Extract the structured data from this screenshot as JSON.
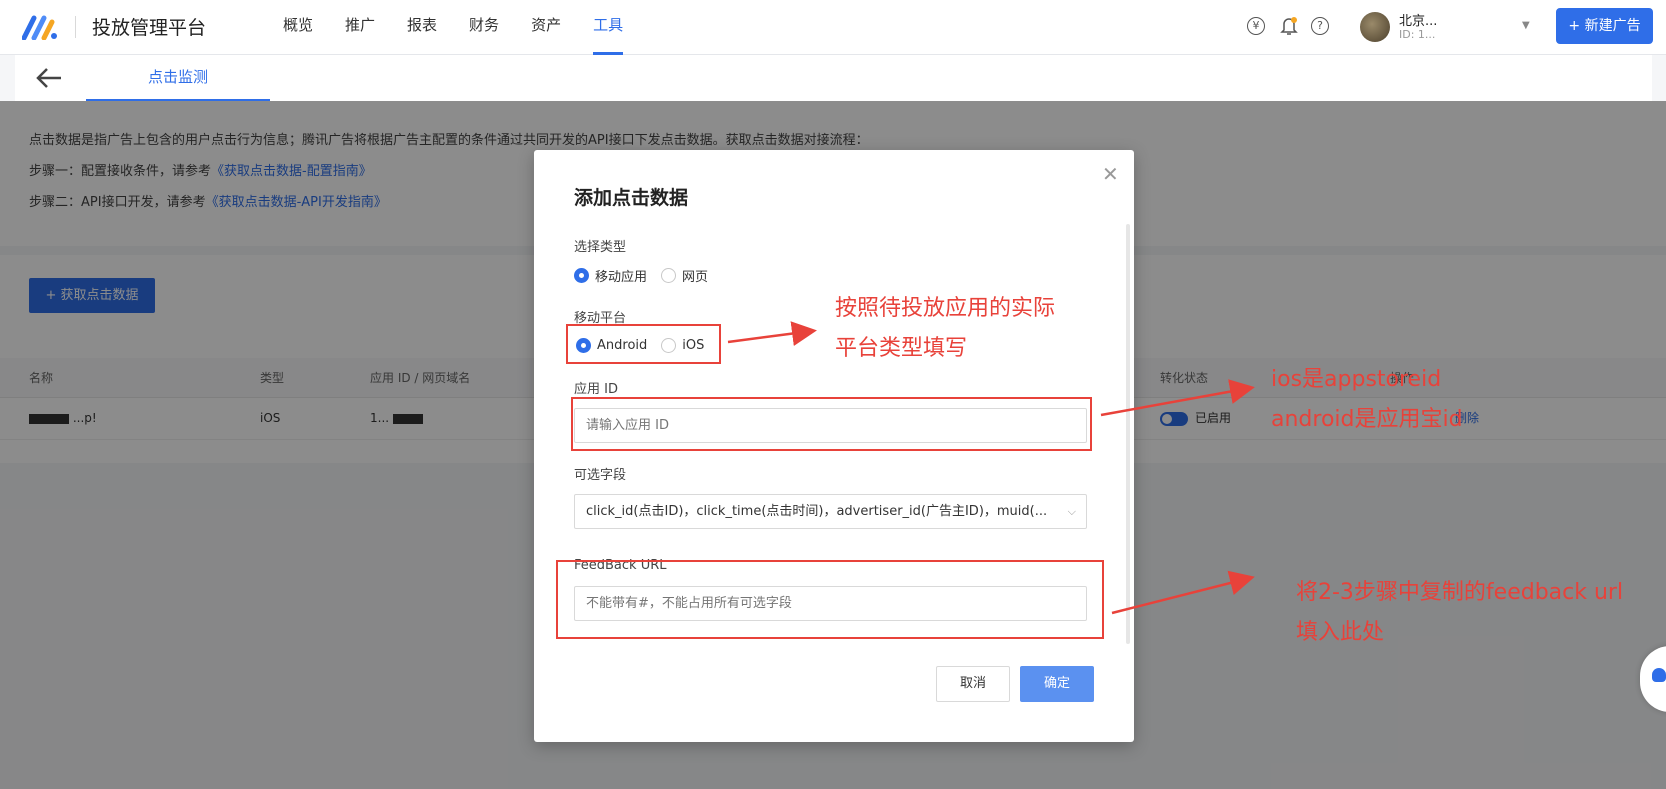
{
  "header": {
    "app_title": "投放管理平台",
    "nav": [
      "概览",
      "推广",
      "报表",
      "财务",
      "资产",
      "工具"
    ],
    "active_nav": "工具",
    "icons": [
      "coin-icon",
      "bell-icon",
      "help-icon"
    ],
    "account_name": "北京...",
    "account_id": "ID: 1...",
    "new_ad_label": "+ 新建广告"
  },
  "subheader": {
    "tab": "点击监测"
  },
  "info": {
    "line1": "点击数据是指广告上包含的用户点击行为信息；腾讯广告将根据广告主配置的条件通过共同开发的API接口下发点击数据。获取点击数据对接流程：",
    "step1_prefix": "步骤一：配置接收条件，请参考",
    "step1_link": "《获取点击数据-配置指南》",
    "step2_prefix": "步骤二：API接口开发，请参考",
    "step2_link": "《获取点击数据-API开发指南》"
  },
  "list": {
    "fetch_button": "+ 获取点击数据",
    "columns": [
      "名称",
      "类型",
      "应用 ID / 网页域名",
      "转化状态",
      "操作"
    ],
    "row": {
      "name": "...p!",
      "type": "iOS",
      "app_id": "1...",
      "status": "已启用",
      "action_delete": "删除"
    }
  },
  "modal": {
    "title": "添加点击数据",
    "type_label": "选择类型",
    "type_options": [
      "移动应用",
      "网页"
    ],
    "type_selected": "移动应用",
    "platform_label": "移动平台",
    "platform_options": [
      "Android",
      "iOS"
    ],
    "platform_selected": "Android",
    "app_id_label": "应用 ID",
    "app_id_placeholder": "请输入应用 ID",
    "optional_label": "可选字段",
    "optional_value": "click_id(点击ID)，click_time(点击时间)，advertiser_id(广告主ID)，muid(...",
    "feedback_label": "FeedBack URL",
    "feedback_placeholder": "不能带有#，不能占用所有可选字段",
    "cancel_label": "取消",
    "ok_label": "确定"
  },
  "annotations": {
    "platform_note_line1": "按照待投放应用的实际",
    "platform_note_line2": "平台类型填写",
    "appid_note_line1": "ios是appstoreid",
    "appid_note_line2": "android是应用宝id",
    "feedback_note_line1": "将2-3步骤中复制的feedback url",
    "feedback_note_line2": "填入此处",
    "color": "#e8423a"
  },
  "colors": {
    "primary": "#2f6ee8",
    "annotation": "#e8423a"
  }
}
